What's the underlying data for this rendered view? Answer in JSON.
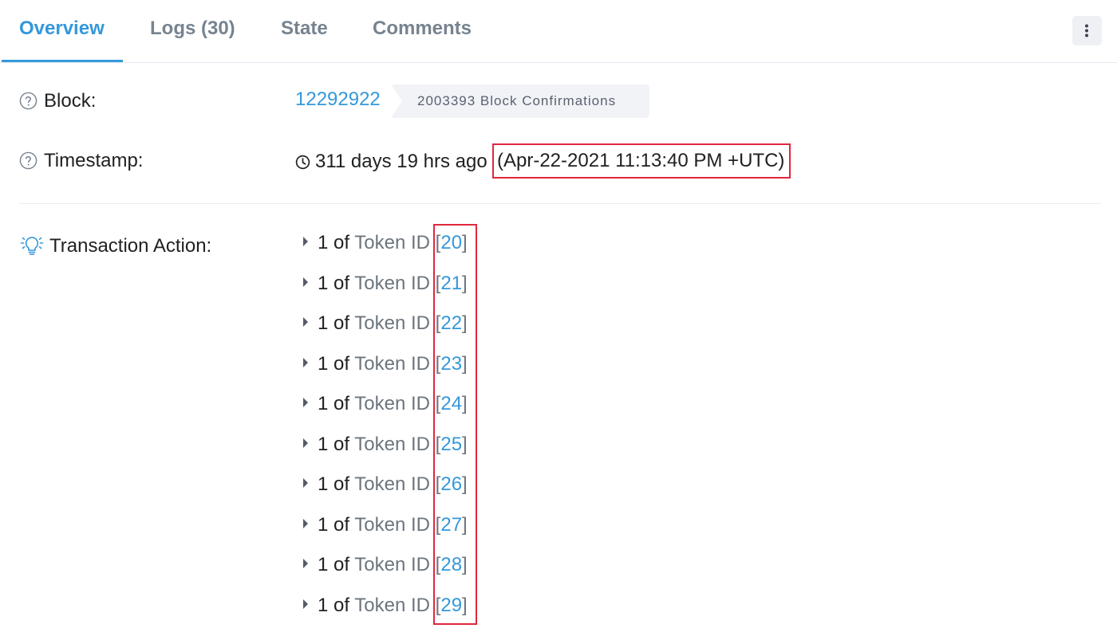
{
  "tabs": [
    {
      "label": "Overview",
      "active": true
    },
    {
      "label": "Logs (30)",
      "active": false
    },
    {
      "label": "State",
      "active": false
    },
    {
      "label": "Comments",
      "active": false
    }
  ],
  "menu_icon": "vertical-ellipsis-icon",
  "block": {
    "label": "Block:",
    "number": "12292922",
    "confirmations": "2003393 Block Confirmations"
  },
  "timestamp": {
    "label": "Timestamp:",
    "relative": "311 days 19 hrs ago",
    "absolute": "(Apr-22-2021 11:13:40 PM +UTC)"
  },
  "transaction_action": {
    "label": "Transaction Action:",
    "items": [
      {
        "qty": "1",
        "of": "of",
        "token_label": "Token ID",
        "open": "[",
        "token_id": "20",
        "close": "]"
      },
      {
        "qty": "1",
        "of": "of",
        "token_label": "Token ID",
        "open": "[",
        "token_id": "21",
        "close": "]"
      },
      {
        "qty": "1",
        "of": "of",
        "token_label": "Token ID",
        "open": "[",
        "token_id": "22",
        "close": "]"
      },
      {
        "qty": "1",
        "of": "of",
        "token_label": "Token ID",
        "open": "[",
        "token_id": "23",
        "close": "]"
      },
      {
        "qty": "1",
        "of": "of",
        "token_label": "Token ID",
        "open": "[",
        "token_id": "24",
        "close": "]"
      },
      {
        "qty": "1",
        "of": "of",
        "token_label": "Token ID",
        "open": "[",
        "token_id": "25",
        "close": "]"
      },
      {
        "qty": "1",
        "of": "of",
        "token_label": "Token ID",
        "open": "[",
        "token_id": "26",
        "close": "]"
      },
      {
        "qty": "1",
        "of": "of",
        "token_label": "Token ID",
        "open": "[",
        "token_id": "27",
        "close": "]"
      },
      {
        "qty": "1",
        "of": "of",
        "token_label": "Token ID",
        "open": "[",
        "token_id": "28",
        "close": "]"
      },
      {
        "qty": "1",
        "of": "of",
        "token_label": "Token ID",
        "open": "[",
        "token_id": "29",
        "close": "]"
      }
    ]
  },
  "colors": {
    "accent": "#3498db",
    "highlight": "#e0273e",
    "muted": "#6c757e"
  }
}
